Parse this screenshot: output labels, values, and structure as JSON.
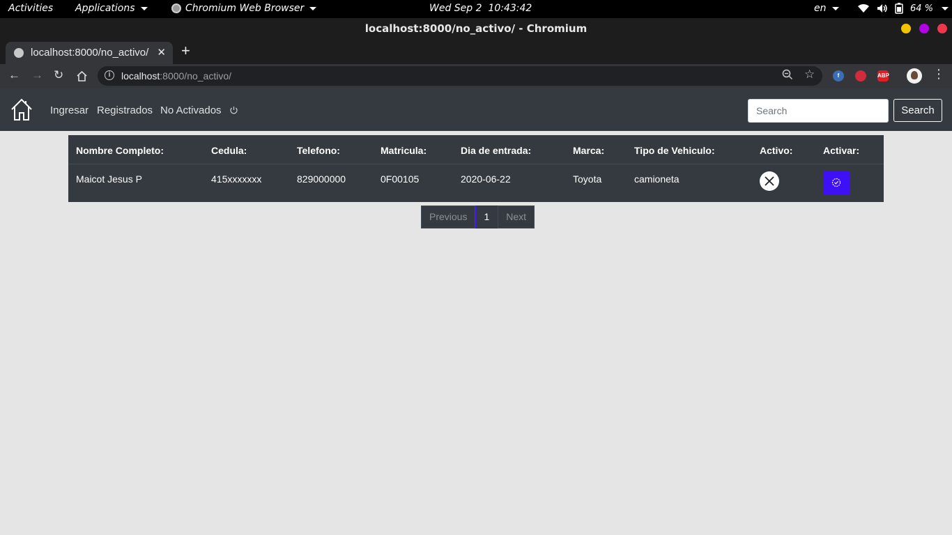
{
  "system_bar": {
    "activities": "Activities",
    "applications": "Applications",
    "app_name": "Chromium Web Browser",
    "clock": "Wed Sep 2  10:43:42",
    "language": "en",
    "battery": "64 %"
  },
  "window": {
    "title": "localhost:8000/no_activo/ - Chromium",
    "button_colors": [
      "#f3c300",
      "#b400e6",
      "#f0364b"
    ]
  },
  "tab": {
    "title": "localhost:8000/no_activo/",
    "close": "✕",
    "new_tab": "+"
  },
  "omnibox": {
    "url_host": "localhost",
    "url_rest": ":8000/no_activo/",
    "info": "i"
  },
  "extensions": [
    {
      "name": "fedora-extension-icon",
      "label": "f",
      "color": "#3c6eb4"
    },
    {
      "name": "extension-icon-red",
      "label": "",
      "color": "#d12b3c"
    },
    {
      "name": "adblock-plus-icon",
      "label": "ABP",
      "color": "#e31c23"
    }
  ],
  "navbar": {
    "links": [
      "Ingresar",
      "Registrados",
      "No Activados"
    ],
    "search_placeholder": "Search",
    "search_button": "Search"
  },
  "table": {
    "headers": [
      "Nombre Completo:",
      "Cedula:",
      "Telefono:",
      "Matricula:",
      "Dia de entrada:",
      "Marca:",
      "Tipo de Vehiculo:",
      "Activo:",
      "Activar:"
    ],
    "rows": [
      {
        "nombre": "Maicot Jesus P",
        "cedula": "415xxxxxxx",
        "telefono": "829000000",
        "matricula": "0F00105",
        "dia_entrada": "2020-06-22",
        "marca": "Toyota",
        "tipo": "camioneta",
        "activo": false
      }
    ]
  },
  "pagination": {
    "previous": "Previous",
    "current": "1",
    "next": "Next"
  },
  "colors": {
    "navbar_bg": "#343a40",
    "accent": "#3d10f5",
    "page_bg": "#e5e5e5"
  }
}
